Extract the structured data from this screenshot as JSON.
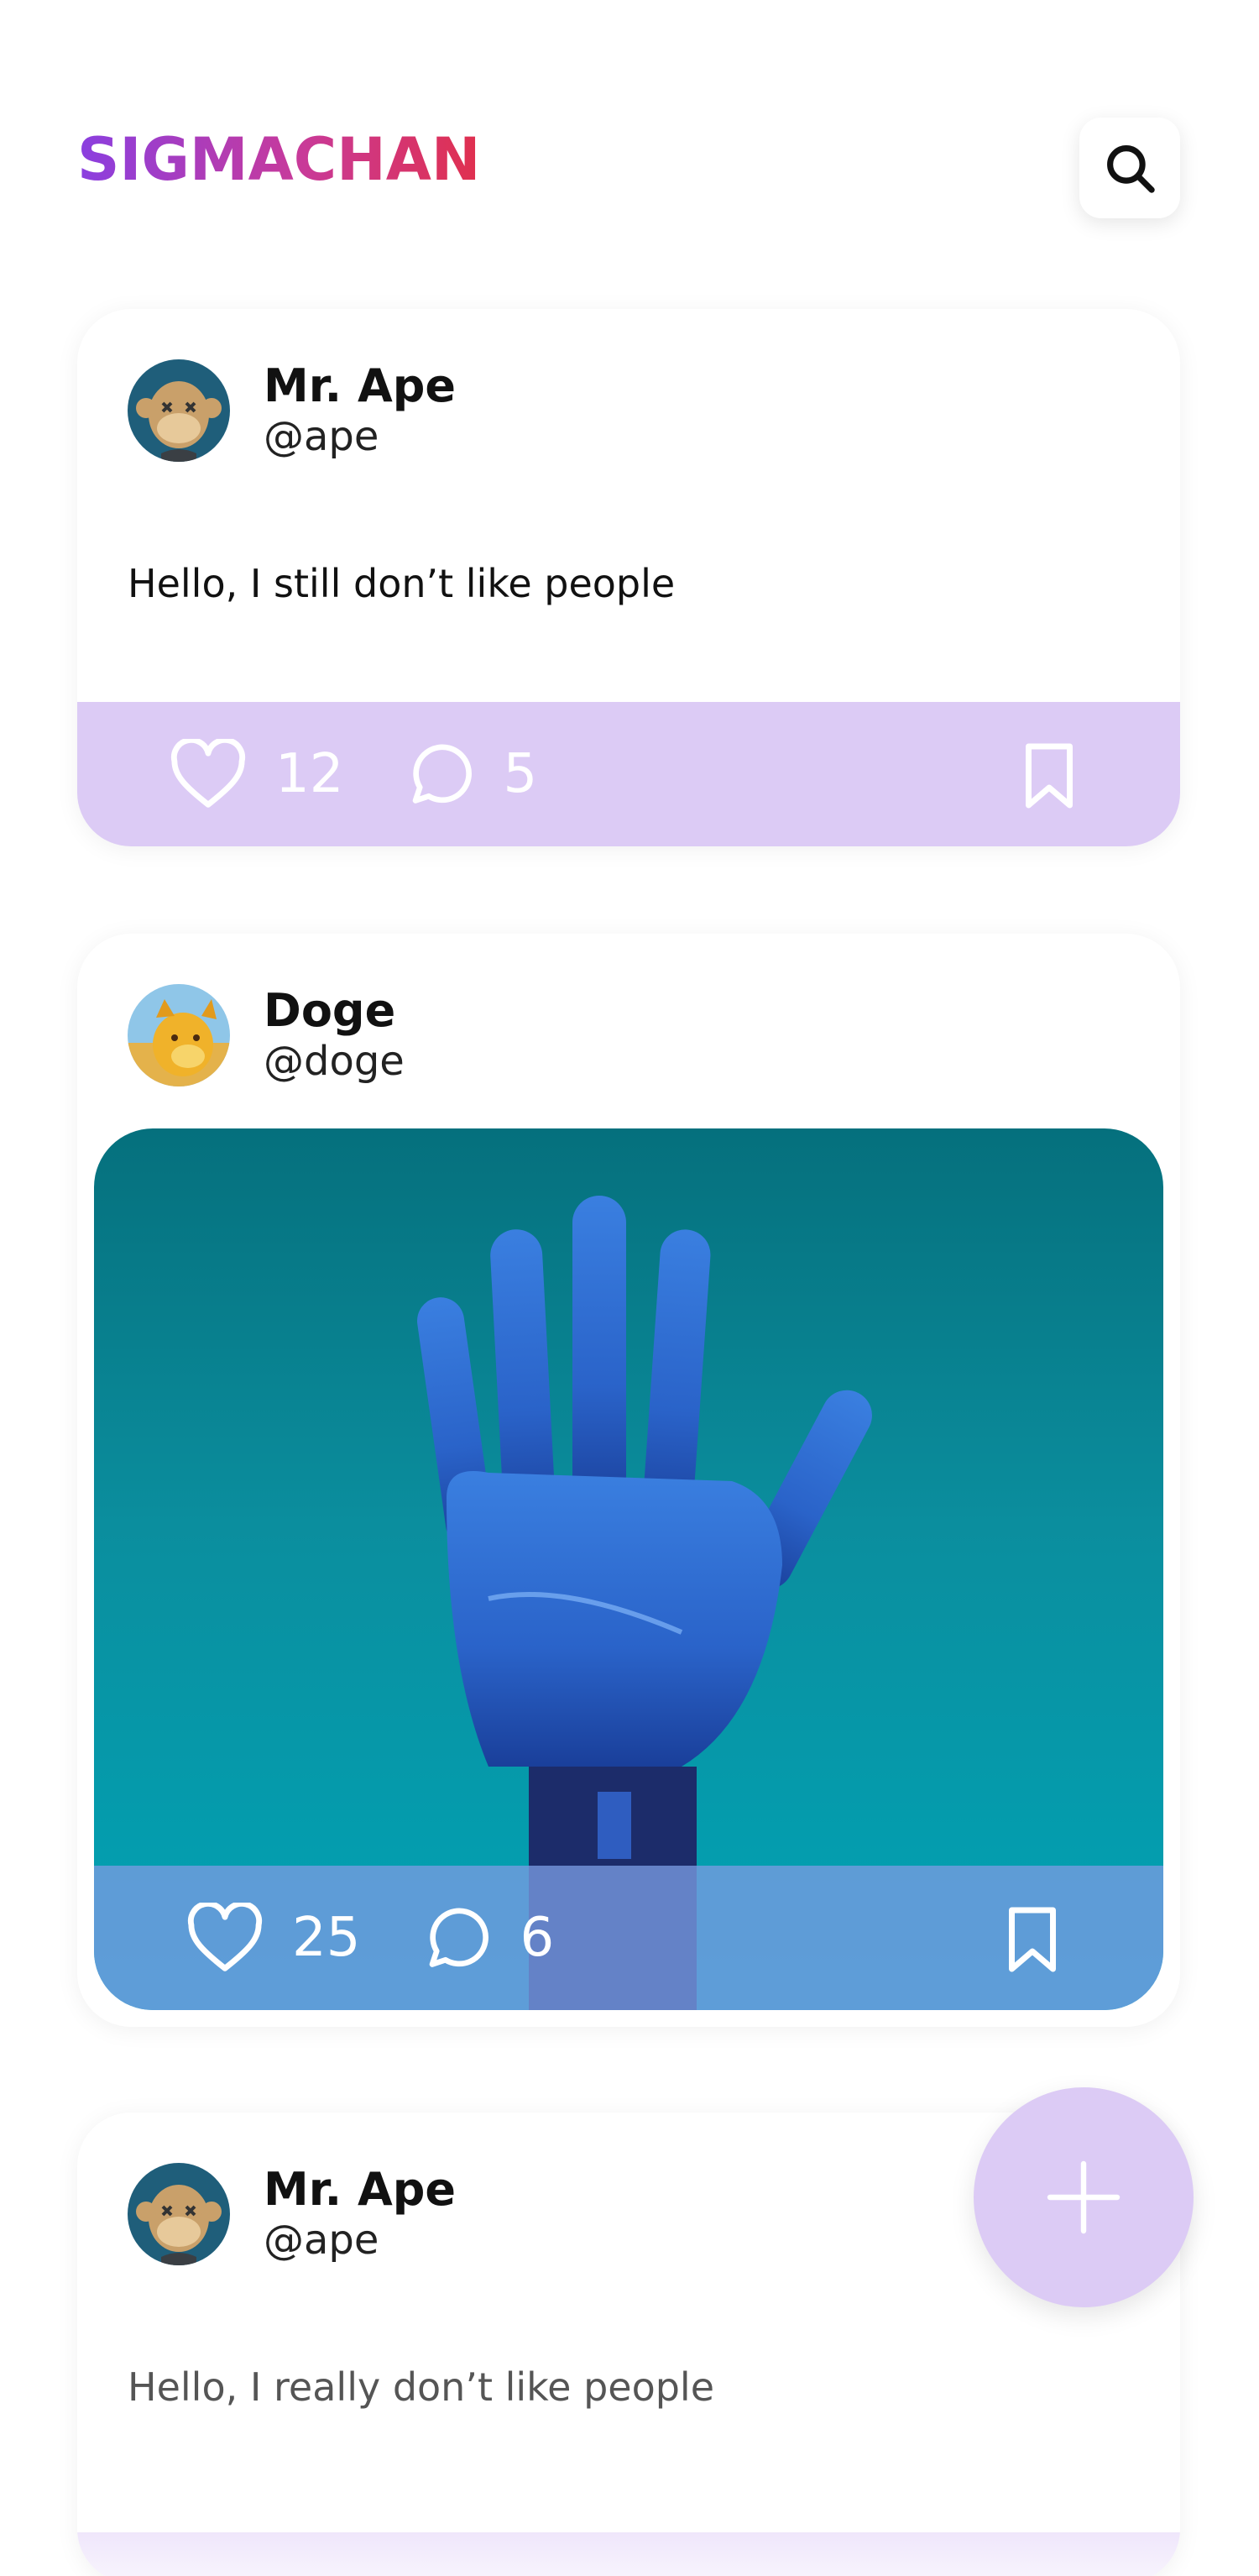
{
  "app": {
    "brand": "SIGMACHAN",
    "colors": {
      "brand_start": "#8a3fe0",
      "brand_end": "#e0304e",
      "accent": "#dccbf5"
    }
  },
  "header": {
    "search_icon": "search-icon"
  },
  "posts": [
    {
      "author": "Mr. Ape",
      "handle": "@ape",
      "text": "Hello, I still don’t like people",
      "likes": "12",
      "comments": "5"
    },
    {
      "author": "Doge",
      "handle": "@doge",
      "image": "robot-hand-photo",
      "likes": "25",
      "comments": "6"
    },
    {
      "author": "Mr. Ape",
      "handle": "@ape",
      "text": "Hello, I really don’t like people"
    }
  ],
  "fab": {
    "icon": "plus-icon"
  }
}
